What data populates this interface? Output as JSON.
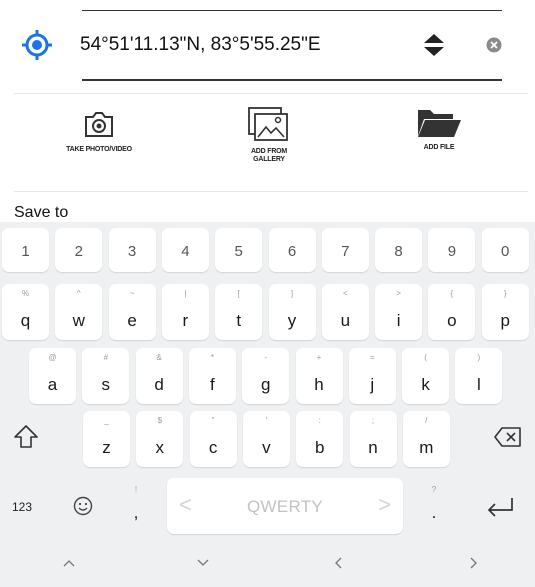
{
  "location": {
    "coordinates": "54°51'11.13\"N, 83°5'55.25\"E",
    "accent_color": "#1a73e8"
  },
  "actions": [
    {
      "label": "TAKE PHOTO/VIDEO",
      "icon": "camera-icon"
    },
    {
      "label": "ADD FROM\nGALLERY",
      "icon": "gallery-icon"
    },
    {
      "label": "ADD FILE",
      "icon": "folder-icon"
    }
  ],
  "save_to_label": "Save to",
  "keyboard": {
    "number_row": [
      "1",
      "2",
      "3",
      "4",
      "5",
      "6",
      "7",
      "8",
      "9",
      "0"
    ],
    "row1": [
      {
        "main": "q",
        "sub": "%"
      },
      {
        "main": "w",
        "sub": "^"
      },
      {
        "main": "e",
        "sub": "~"
      },
      {
        "main": "r",
        "sub": "|"
      },
      {
        "main": "t",
        "sub": "["
      },
      {
        "main": "y",
        "sub": "]"
      },
      {
        "main": "u",
        "sub": "<"
      },
      {
        "main": "i",
        "sub": ">"
      },
      {
        "main": "o",
        "sub": "{"
      },
      {
        "main": "p",
        "sub": "}"
      }
    ],
    "row2": [
      {
        "main": "a",
        "sub": "@"
      },
      {
        "main": "s",
        "sub": "#"
      },
      {
        "main": "d",
        "sub": "&"
      },
      {
        "main": "f",
        "sub": "*"
      },
      {
        "main": "g",
        "sub": "-"
      },
      {
        "main": "h",
        "sub": "+"
      },
      {
        "main": "j",
        "sub": "="
      },
      {
        "main": "k",
        "sub": "("
      },
      {
        "main": "l",
        "sub": ")"
      }
    ],
    "row3": [
      {
        "main": "z",
        "sub": "_"
      },
      {
        "main": "x",
        "sub": "$"
      },
      {
        "main": "c",
        "sub": "\""
      },
      {
        "main": "v",
        "sub": "'"
      },
      {
        "main": "b",
        "sub": ":"
      },
      {
        "main": "n",
        "sub": ";"
      },
      {
        "main": "m",
        "sub": "/"
      }
    ],
    "symbols_label": "123",
    "comma": {
      "main": ",",
      "sub": "!"
    },
    "space_label": "QWERTY",
    "space_left": "<",
    "space_right": ">",
    "period": {
      "main": ".",
      "sub": "?"
    }
  }
}
